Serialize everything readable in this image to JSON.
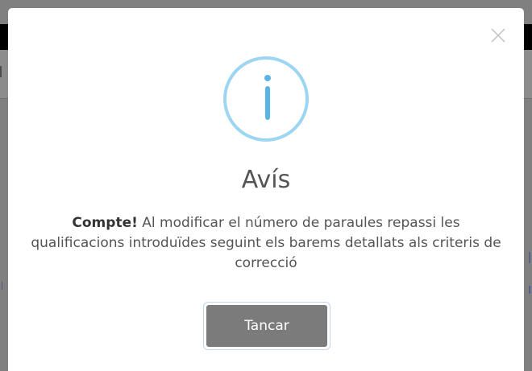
{
  "dialog": {
    "title": "Avís",
    "message_strong": "Compte!",
    "message_text": " Al modificar el número de paraules repassi les qualificacions introduïdes seguint els barems detallats als criteris de correcció",
    "button_label": "Tancar",
    "icon": "info-icon",
    "close_icon": "close-icon"
  },
  "colors": {
    "backdrop": "#808080",
    "icon_ring": "#9dd6f3",
    "icon_glyph": "#5ab4e6",
    "text": "#545454",
    "button": "#7b7b7b"
  }
}
